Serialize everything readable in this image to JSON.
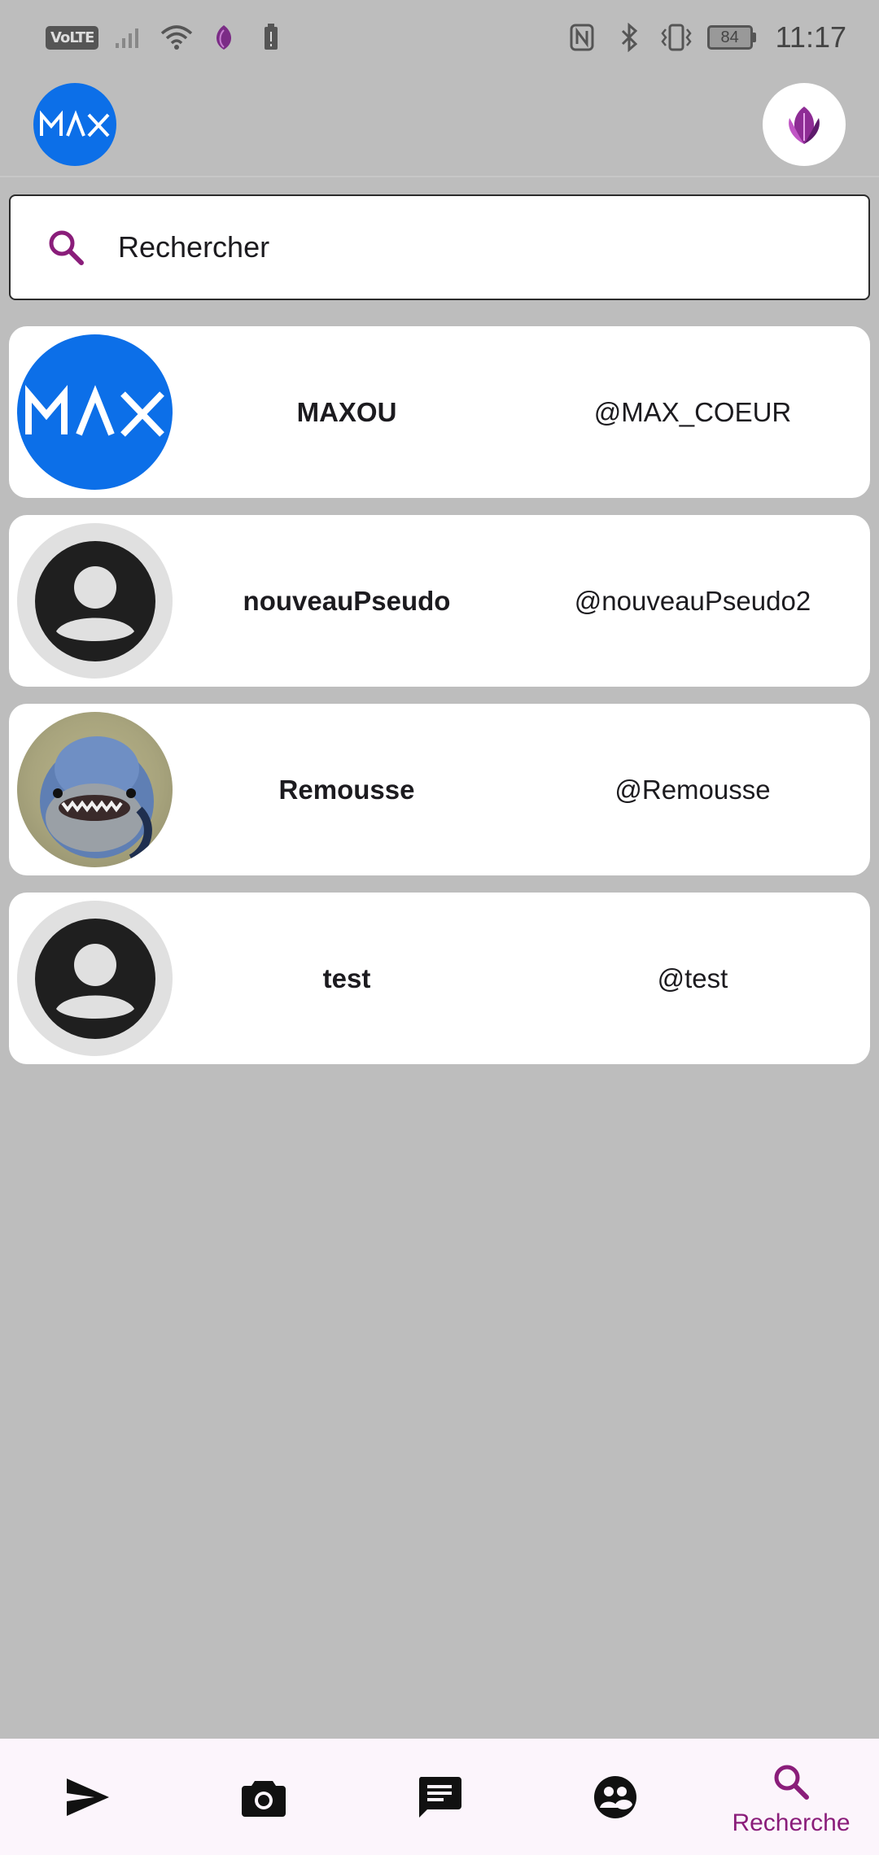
{
  "status_bar": {
    "volte": "VoLTE",
    "battery_level": "84",
    "time": "11:17"
  },
  "search": {
    "placeholder": "Rechercher"
  },
  "users": [
    {
      "name": "MAXOU",
      "handle": "@MAX_COEUR",
      "avatar": "max-logo"
    },
    {
      "name": "nouveauPseudo",
      "handle": "@nouveauPseudo2",
      "avatar": "default-user"
    },
    {
      "name": "Remousse",
      "handle": "@Remousse",
      "avatar": "shark-photo"
    },
    {
      "name": "test",
      "handle": "@test",
      "avatar": "default-user"
    }
  ],
  "bottom_nav": {
    "items": [
      {
        "icon": "send-icon",
        "label": ""
      },
      {
        "icon": "camera-icon",
        "label": ""
      },
      {
        "icon": "message-icon",
        "label": ""
      },
      {
        "icon": "friends-icon",
        "label": ""
      },
      {
        "icon": "search-icon",
        "label": "Recherche",
        "active": true
      }
    ]
  },
  "colors": {
    "accent": "#8a1d7a",
    "background": "#bdbdbd",
    "card": "#ffffff",
    "max_blue": "#0c6fe8",
    "nav_background": "#fcf5fc"
  }
}
